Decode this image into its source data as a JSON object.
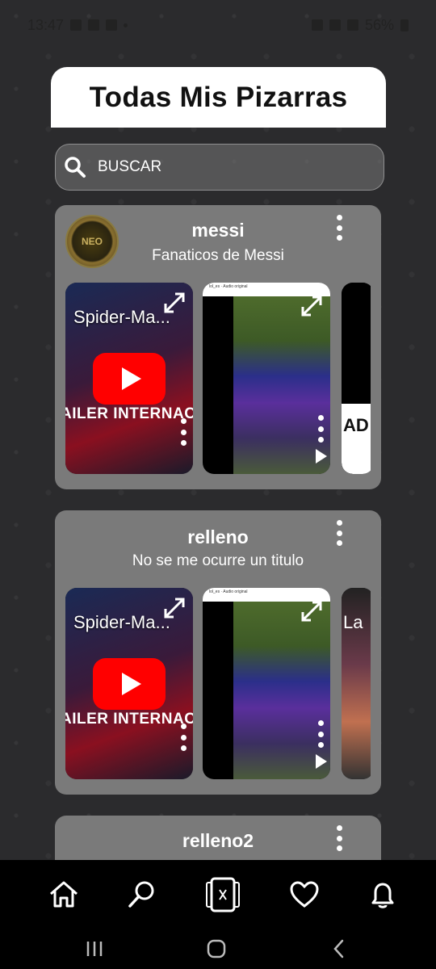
{
  "status_bar": {
    "time": "13:47",
    "battery": "56%"
  },
  "page_title": "Todas Mis Pizarras",
  "search": {
    "placeholder": "BUSCAR"
  },
  "boards": [
    {
      "name": "messi",
      "subtitle": "Fanaticos de Messi",
      "has_avatar": true,
      "avatar_text": "NEO",
      "thumbnails": [
        {
          "type": "youtube",
          "title": "Spider-Ma...",
          "caption": "AILER INTERNACIO"
        },
        {
          "type": "game-video",
          "header_user": "lol_es",
          "header_sub": "Audio original"
        },
        {
          "type": "partial",
          "text": "AD"
        }
      ]
    },
    {
      "name": "relleno",
      "subtitle": "No se me ocurre un titulo",
      "has_avatar": false,
      "thumbnails": [
        {
          "type": "youtube",
          "title": "Spider-Ma...",
          "caption": "AILER INTERNACIO"
        },
        {
          "type": "game-video",
          "header_user": "lol_es",
          "header_sub": "Audio original"
        },
        {
          "type": "partial",
          "text": "La"
        }
      ]
    },
    {
      "name": "relleno2",
      "subtitle": "",
      "has_avatar": false,
      "thumbnails": []
    }
  ],
  "bottom_nav": [
    {
      "icon": "home-icon"
    },
    {
      "icon": "search-icon"
    },
    {
      "icon": "boards-icon"
    },
    {
      "icon": "heart-icon"
    },
    {
      "icon": "bell-icon"
    }
  ],
  "system_nav": [
    {
      "icon": "recent-apps-icon"
    },
    {
      "icon": "home-circle-icon"
    },
    {
      "icon": "back-icon"
    }
  ]
}
